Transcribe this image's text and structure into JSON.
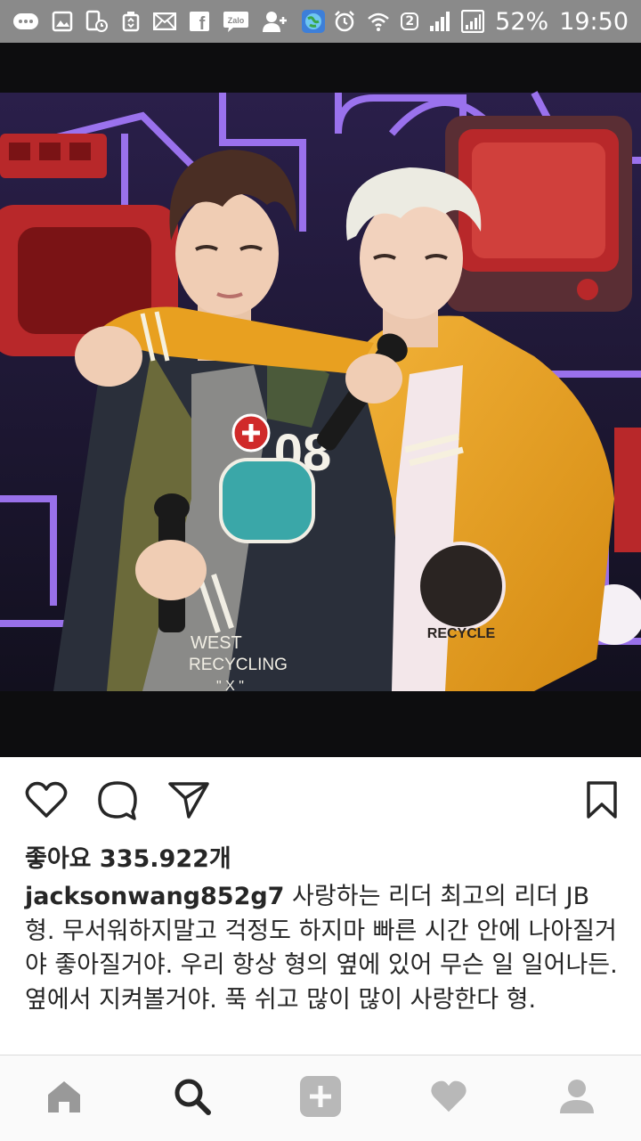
{
  "status_bar": {
    "icons": [
      "chat-bubble-icon",
      "image-icon",
      "phone-clock-icon",
      "recycle-icon",
      "mail-icon",
      "facebook-icon",
      "zalo-icon",
      "add-user-icon",
      "globe-app-icon",
      "alarm-icon",
      "wifi-icon",
      "sim-2-icon",
      "signal-icon",
      "signal-box-icon"
    ],
    "zalo_label": "Zalo",
    "facebook_label": "f",
    "sim_label": "2",
    "battery": "52%",
    "time": "19:50"
  },
  "post": {
    "image_text": {
      "patch_number": "08",
      "jacket_text": "WEST",
      "jacket_recycling": "RECYCLING",
      "jacket_x": "\" X \"",
      "recycle_patch": "RECYCLE"
    },
    "likes": "좋아요 335.922개",
    "caption_user": "jacksonwang852g7",
    "caption_text": " 사랑하는 리더 최고의 리더 JB 형. 무서워하지말고 걱정도 하지마 빠른 시간 안에 나아질거야 좋아질거야. 우리 항상 형의 옆에 있어 무슨 일 일어나든. 옆에서 지켜볼거야. 푹 쉬고 많이 많이 사랑한다 형."
  },
  "actions": [
    "heart-icon",
    "comment-icon",
    "share-icon",
    "bookmark-icon"
  ],
  "nav": [
    "home-icon",
    "search-icon",
    "add-post-icon",
    "activity-heart-icon",
    "profile-icon"
  ],
  "colors": {
    "status_bar": "#8a8a8a",
    "text": "#262626",
    "nav_icon": "#999999",
    "nav_active": "#262626",
    "varsity_yellow": "#e8a020"
  }
}
